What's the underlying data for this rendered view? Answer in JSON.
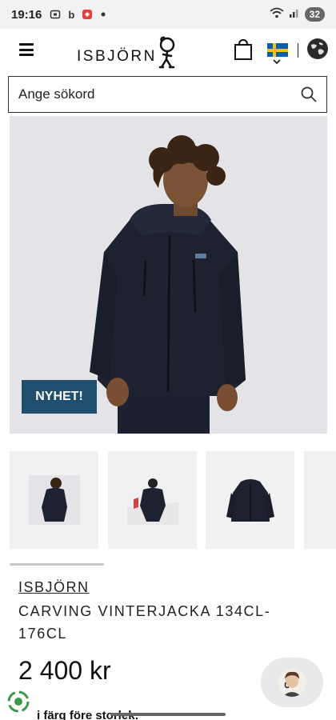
{
  "statusbar": {
    "time": "19:16",
    "battery": "32",
    "icons": [
      "screenshot-icon",
      "b-icon",
      "notification-icon",
      "dot-icon",
      "wifi-icon",
      "signal-icon"
    ]
  },
  "header": {
    "logo_text": "ISBJÖRN",
    "icons": [
      "menu-icon",
      "cart-icon",
      "sweden-flag-icon",
      "globe-icon"
    ]
  },
  "search": {
    "placeholder": "Ange sökord"
  },
  "hero": {
    "badge": "NYHET!"
  },
  "product": {
    "brand": "ISBJÖRN",
    "name": "CARVING VINTERJACKA 134CL-176CL",
    "price": "2 400 kr",
    "color_prompt": "i färg före storlek:"
  },
  "colors": {
    "badge_bg": "#1f4e6e",
    "hero_bg": "#e4e4e8",
    "thumb_bg": "#f1f1f1",
    "jacket": "#1e2230"
  }
}
